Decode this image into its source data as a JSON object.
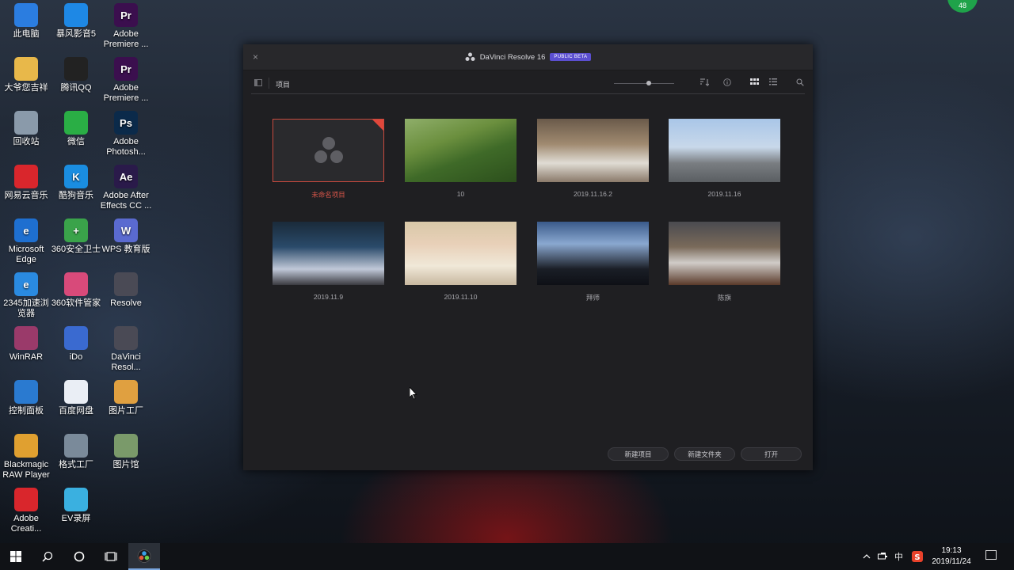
{
  "desktop": {
    "icons": [
      {
        "label": "此电脑",
        "icon": "computer-icon",
        "color": "#2b7de0"
      },
      {
        "label": "暴风影音5",
        "icon": "baofeng-icon",
        "color": "#1e88e5"
      },
      {
        "label": "Adobe Premiere ...",
        "icon": "premiere-icon",
        "glyph": "Pr",
        "color": "#3b0f4e"
      },
      {
        "label": "大爷您吉祥",
        "icon": "folder-icon",
        "color": "#e8b84a"
      },
      {
        "label": "腾讯QQ",
        "icon": "qq-icon",
        "color": "#222"
      },
      {
        "label": "Adobe Premiere ...",
        "icon": "premiere-icon",
        "glyph": "Pr",
        "color": "#3b0f4e"
      },
      {
        "label": "回收站",
        "icon": "recycle-bin-icon",
        "color": "#8a9aaa"
      },
      {
        "label": "微信",
        "icon": "wechat-icon",
        "color": "#2aae45"
      },
      {
        "label": "Adobe Photosh...",
        "icon": "photoshop-icon",
        "glyph": "Ps",
        "color": "#0b2a4a"
      },
      {
        "label": "网易云音乐",
        "icon": "netease-music-icon",
        "color": "#d9262c"
      },
      {
        "label": "酷狗音乐",
        "icon": "kugou-icon",
        "glyph": "K",
        "color": "#1a8de0"
      },
      {
        "label": "Adobe After Effects CC ...",
        "icon": "after-effects-icon",
        "glyph": "Ae",
        "color": "#2a1a4a"
      },
      {
        "label": "Microsoft Edge",
        "icon": "edge-icon",
        "glyph": "e",
        "color": "#1e6fd0"
      },
      {
        "label": "360安全卫士",
        "icon": "360-security-icon",
        "glyph": "+",
        "color": "#3aa34a"
      },
      {
        "label": "WPS 教育版",
        "icon": "wps-icon",
        "glyph": "W",
        "color": "#5a6ad0"
      },
      {
        "label": "2345加速浏览器",
        "icon": "browser-2345-icon",
        "glyph": "e",
        "color": "#2a8ae0"
      },
      {
        "label": "360软件管家",
        "icon": "360-software-icon",
        "color": "#d84a7a"
      },
      {
        "label": "Resolve",
        "icon": "resolve-icon",
        "color": "#4a4a55"
      },
      {
        "label": "WinRAR",
        "icon": "winrar-icon",
        "color": "#9a3a6a"
      },
      {
        "label": "iDo",
        "icon": "ido-icon",
        "color": "#3a6ad0"
      },
      {
        "label": "DaVinci Resol...",
        "icon": "davinci-icon",
        "color": "#4a4a55"
      },
      {
        "label": "控制面板",
        "icon": "control-panel-icon",
        "color": "#2a7ad0"
      },
      {
        "label": "百度网盘",
        "icon": "baidu-pan-icon",
        "color": "#eaeef5"
      },
      {
        "label": "图片工厂",
        "icon": "picture-factory-icon",
        "color": "#e0a040"
      },
      {
        "label": "Blackmagic RAW Player",
        "icon": "blackmagic-raw-icon",
        "color": "#e0a030"
      },
      {
        "label": "格式工厂",
        "icon": "format-factory-icon",
        "color": "#7a8a9a"
      },
      {
        "label": "图片馆",
        "icon": "picture-gallery-icon",
        "color": "#7a9a6a"
      },
      {
        "label": "Adobe Creati...",
        "icon": "creative-cloud-icon",
        "color": "#d9262c"
      },
      {
        "label": "EV录屏",
        "icon": "ev-recorder-icon",
        "color": "#3ab0e0"
      }
    ],
    "badge": "48"
  },
  "window": {
    "title": "DaVinci Resolve 16",
    "beta_label": "PUBLIC BETA",
    "close_label": "×",
    "toolbar": {
      "title": "项目",
      "zoom_level": 0.58
    },
    "projects": [
      {
        "name": "未命名项目",
        "selected": true,
        "thumb": "placeholder"
      },
      {
        "name": "10",
        "selected": false,
        "thumb": "field"
      },
      {
        "name": "2019.11.16.2",
        "selected": false,
        "thumb": "banquet"
      },
      {
        "name": "2019.11.16",
        "selected": false,
        "thumb": "bridge"
      },
      {
        "name": "2019.11.9",
        "selected": false,
        "thumb": "wedding"
      },
      {
        "name": "2019.11.10",
        "selected": false,
        "thumb": "balloons"
      },
      {
        "name": "拜师",
        "selected": false,
        "thumb": "stage"
      },
      {
        "name": "陈旗",
        "selected": false,
        "thumb": "meeting"
      }
    ],
    "buttons": {
      "new_project": "新建项目",
      "new_folder": "新建文件夹",
      "open": "打开"
    }
  },
  "taskbar": {
    "ime": "中",
    "time": "19:13",
    "date": "2019/11/24"
  },
  "colors": {
    "accent_red": "#d9564a",
    "beta_purple": "#5b4fd0"
  }
}
